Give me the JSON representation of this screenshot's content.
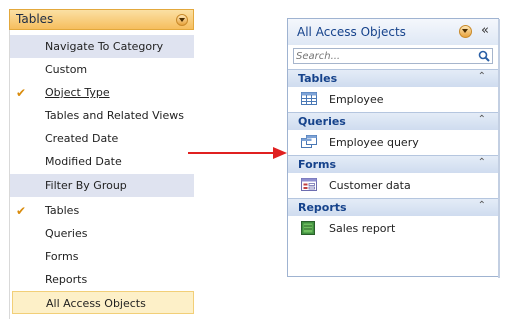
{
  "menu": {
    "header": "Tables",
    "items": [
      {
        "label": "Navigate To Category",
        "kind": "section",
        "checked": false
      },
      {
        "label": "Custom",
        "kind": "item",
        "checked": false
      },
      {
        "label": "Object Type",
        "kind": "item",
        "checked": true
      },
      {
        "label": "Tables and Related Views",
        "kind": "item",
        "checked": false
      },
      {
        "label": "Created Date",
        "kind": "item",
        "checked": false
      },
      {
        "label": "Modified Date",
        "kind": "item",
        "checked": false
      },
      {
        "label": "Filter By Group",
        "kind": "section",
        "checked": false
      },
      {
        "label": "Tables",
        "kind": "item",
        "checked": true
      },
      {
        "label": "Queries",
        "kind": "item",
        "checked": false
      },
      {
        "label": "Forms",
        "kind": "item",
        "checked": false
      },
      {
        "label": "Reports",
        "kind": "item",
        "checked": false
      },
      {
        "label": "All Access Objects",
        "kind": "selected",
        "checked": false
      }
    ]
  },
  "nav": {
    "title": "All Access Objects",
    "collapse_glyph": "«",
    "search_placeholder": "Search...",
    "groups": [
      {
        "label": "Tables",
        "objects": [
          {
            "label": "Employee",
            "icon": "table-icon"
          }
        ]
      },
      {
        "label": "Queries",
        "objects": [
          {
            "label": "Employee query",
            "icon": "query-icon"
          }
        ]
      },
      {
        "label": "Forms",
        "objects": [
          {
            "label": "Customer data",
            "icon": "form-icon"
          }
        ]
      },
      {
        "label": "Reports",
        "objects": [
          {
            "label": "Sales report",
            "icon": "report-icon"
          }
        ]
      }
    ]
  },
  "colors": {
    "menu_header": "#f6be5e",
    "section_band": "#dfe3f0",
    "selected_item": "#fdf0c8",
    "checkmark": "#d98b0c",
    "nav_text": "#15428b",
    "arrow": "#e02020"
  }
}
